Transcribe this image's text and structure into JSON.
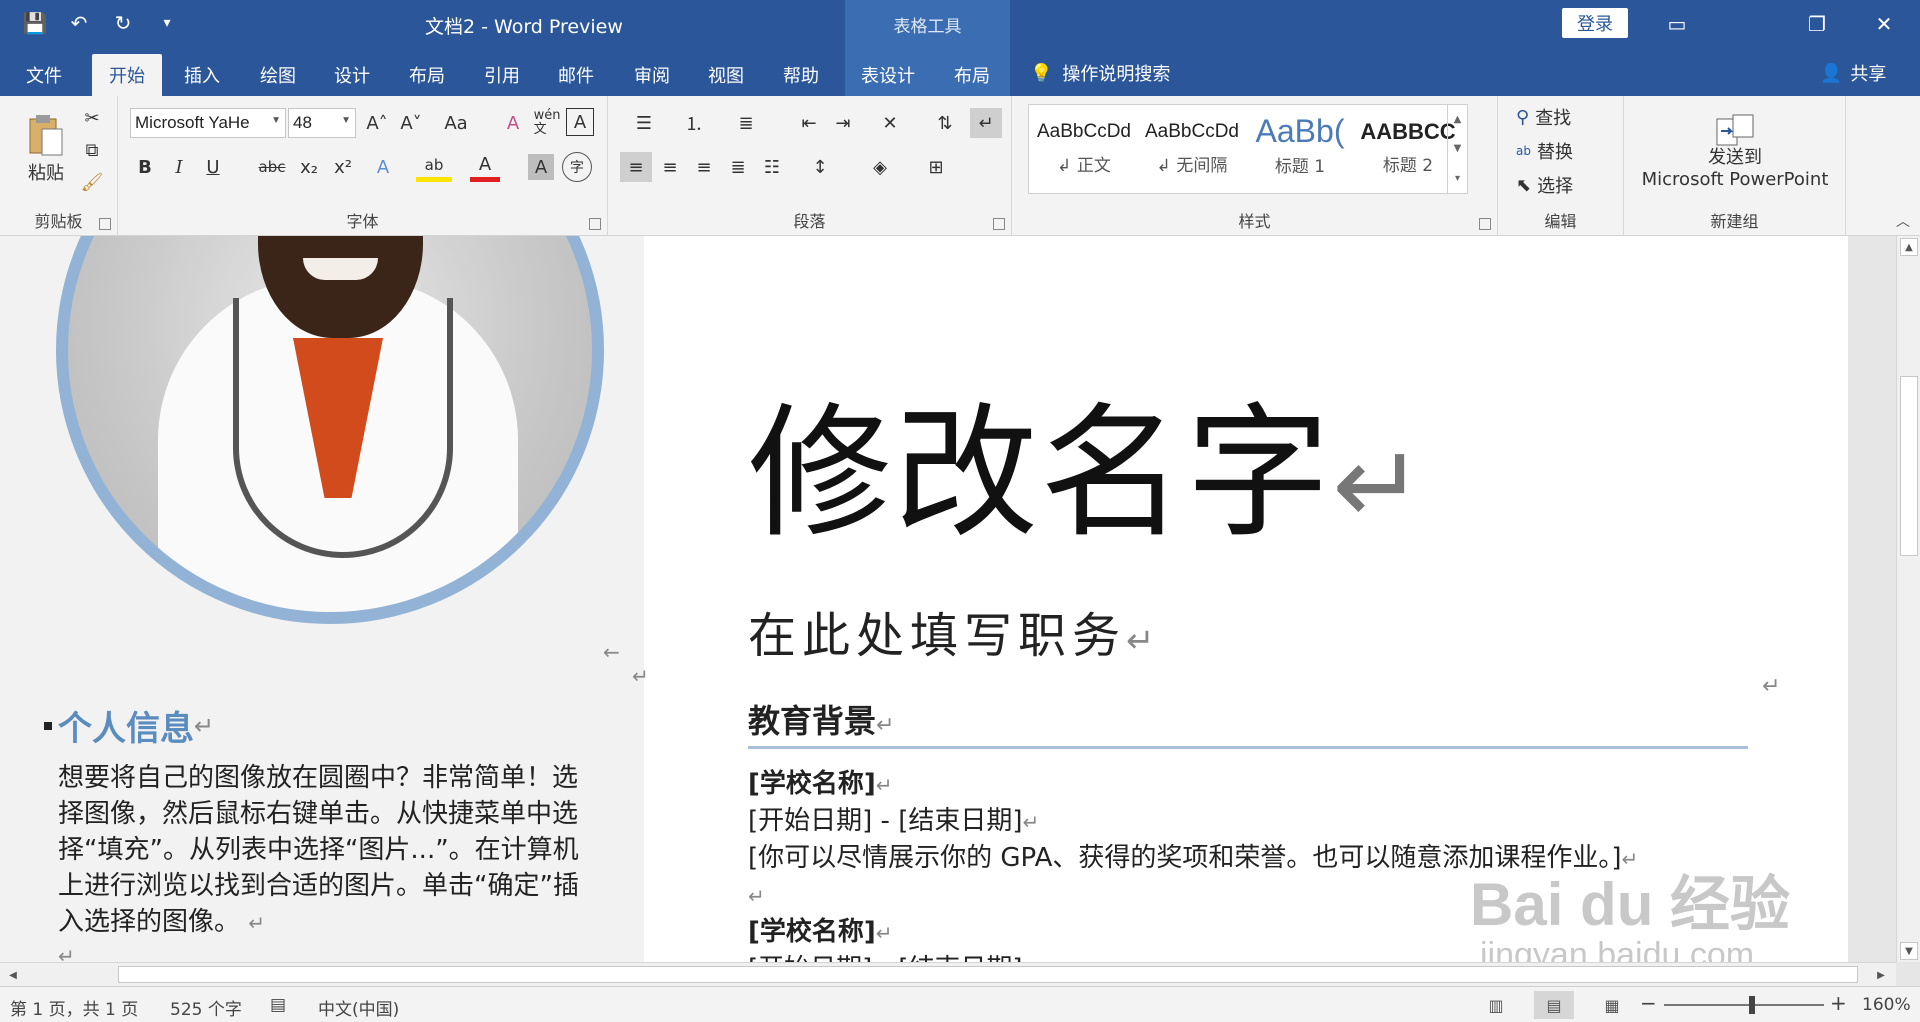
{
  "titlebar": {
    "doc_title": "文档2  -  Word Preview",
    "context_tab_header": "表格工具",
    "login_label": "登录",
    "qat": {
      "save_icon": "💾",
      "undo_icon": "↶",
      "redo_icon": "↻",
      "more_icon": "▾"
    },
    "controls": {
      "ribbon_display": "▭",
      "restore": "❐",
      "close": "✕"
    }
  },
  "tabs": [
    {
      "label": "文件"
    },
    {
      "label": "开始"
    },
    {
      "label": "插入"
    },
    {
      "label": "绘图"
    },
    {
      "label": "设计"
    },
    {
      "label": "布局"
    },
    {
      "label": "引用"
    },
    {
      "label": "邮件"
    },
    {
      "label": "审阅"
    },
    {
      "label": "视图"
    },
    {
      "label": "帮助"
    },
    {
      "label": "表设计"
    },
    {
      "label": "布局"
    }
  ],
  "tellme": {
    "label": "操作说明搜索",
    "icon": "💡"
  },
  "share": {
    "label": "共享",
    "icon": "👤"
  },
  "ribbon": {
    "clipboard": {
      "label": "剪贴板",
      "paste_label": "粘贴"
    },
    "font": {
      "label": "字体",
      "font_name": "Microsoft YaHe",
      "font_size": "48",
      "grow": "A˄",
      "shrink": "A˅",
      "case": "Aa",
      "clear": "A",
      "phonetic": "wén\n文",
      "border": "A",
      "bold": "B",
      "italic": "I",
      "underline": "U",
      "strike": "abc",
      "sub": "x₂",
      "sup": "x²",
      "effects": "A",
      "highlight": "ab",
      "color": "A",
      "shade": "A",
      "enclose": "字"
    },
    "paragraph": {
      "label": "段落"
    },
    "styles": {
      "label": "样式",
      "items": [
        {
          "preview": "AaBbCcDd",
          "name": "↲ 正文"
        },
        {
          "preview": "AaBbCcDd",
          "name": "↲ 无间隔"
        },
        {
          "preview": "AaBb(",
          "name": "标题 1"
        },
        {
          "preview": "AABBCC",
          "name": "标题 2"
        }
      ]
    },
    "editing": {
      "label": "编辑",
      "find": "查找",
      "replace": "替换",
      "select": "选择"
    },
    "newgroup": {
      "label": "新建组",
      "send_line1": "发送到",
      "send_line2": "Microsoft PowerPoint"
    }
  },
  "document": {
    "personal_heading": "个人信息",
    "personal_text": "想要将自己的图像放在圆圈中？非常简单！选择图像，然后鼠标右键单击。从快捷菜单中选择“填充”。从列表中选择“图片...”。在计算机上进行浏览以找到合适的图片。单击“确定”插入选择的图像。",
    "name": "修改名字",
    "job_title": "在此处填写职务",
    "edu_heading": "教育背景",
    "edu_lines": [
      {
        "text": "[学校名称]",
        "bold": true
      },
      {
        "text": "[开始日期] - [结束日期]",
        "bold": false
      },
      {
        "text": "[你可以尽情展示你的 GPA、获得的奖项和荣誉。也可以随意添加课程作业。]",
        "bold": false
      },
      {
        "text": "",
        "bold": false
      },
      {
        "text": "[学校名称]",
        "bold": true
      },
      {
        "text": "[开始日期] - [结束日期]",
        "bold": false
      }
    ],
    "para_mark": "↵"
  },
  "watermark": {
    "line1": "Bai du 经验",
    "line2": "jingyan.baidu.com"
  },
  "statusbar": {
    "page": "第 1 页，共 1 页",
    "words": "525 个字",
    "lang": "中文(中国)",
    "zoom": "160%",
    "zoom_fraction": 0.55
  }
}
